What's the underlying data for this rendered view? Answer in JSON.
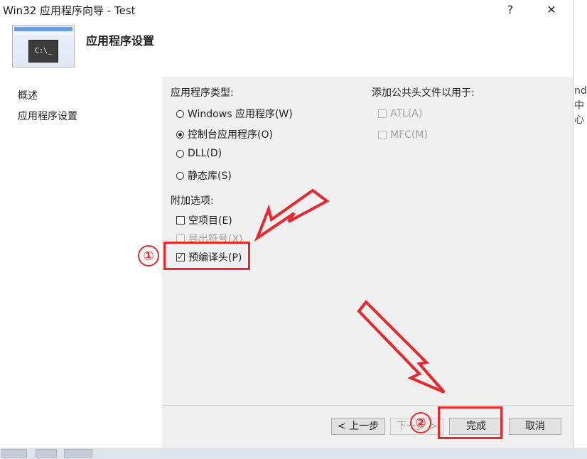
{
  "window": {
    "title": "Win32 应用程序向导 - Test",
    "help_label": "?",
    "close_label": "✕"
  },
  "header": {
    "title": "应用程序设置",
    "thumbnail_icon": "console-app-thumbnail-icon",
    "thumbnail_text": "C:\\_"
  },
  "nav": {
    "items": [
      {
        "label": "概述"
      },
      {
        "label": "应用程序设置"
      }
    ]
  },
  "app_type": {
    "heading": "应用程序类型:",
    "options": [
      {
        "label": "Windows 应用程序(W)",
        "selected": false
      },
      {
        "label": "控制台应用程序(O)",
        "selected": true
      },
      {
        "label": "DLL(D)",
        "selected": false
      },
      {
        "label": "静态库(S)",
        "selected": false
      }
    ]
  },
  "common_headers": {
    "heading": "添加公共头文件以用于:",
    "options": [
      {
        "label": "ATL(A)",
        "checked": false,
        "enabled": false
      },
      {
        "label": "MFC(M)",
        "checked": false,
        "enabled": false
      }
    ]
  },
  "additional": {
    "heading": "附加选项:",
    "options": [
      {
        "label": "空项目(E)",
        "checked": false,
        "enabled": true
      },
      {
        "label": "导出符号(X)",
        "checked": false,
        "enabled": false
      },
      {
        "label": "预编译头(P)",
        "checked": true,
        "enabled": true
      }
    ]
  },
  "buttons": {
    "prev": "< 上一步",
    "next": "下一步 >",
    "finish": "完成",
    "cancel": "取消"
  },
  "annotations": {
    "marker1": "①",
    "marker2": "②",
    "color": "#e8282d"
  },
  "background": {
    "line1": "ndc",
    "line2": "中心"
  }
}
